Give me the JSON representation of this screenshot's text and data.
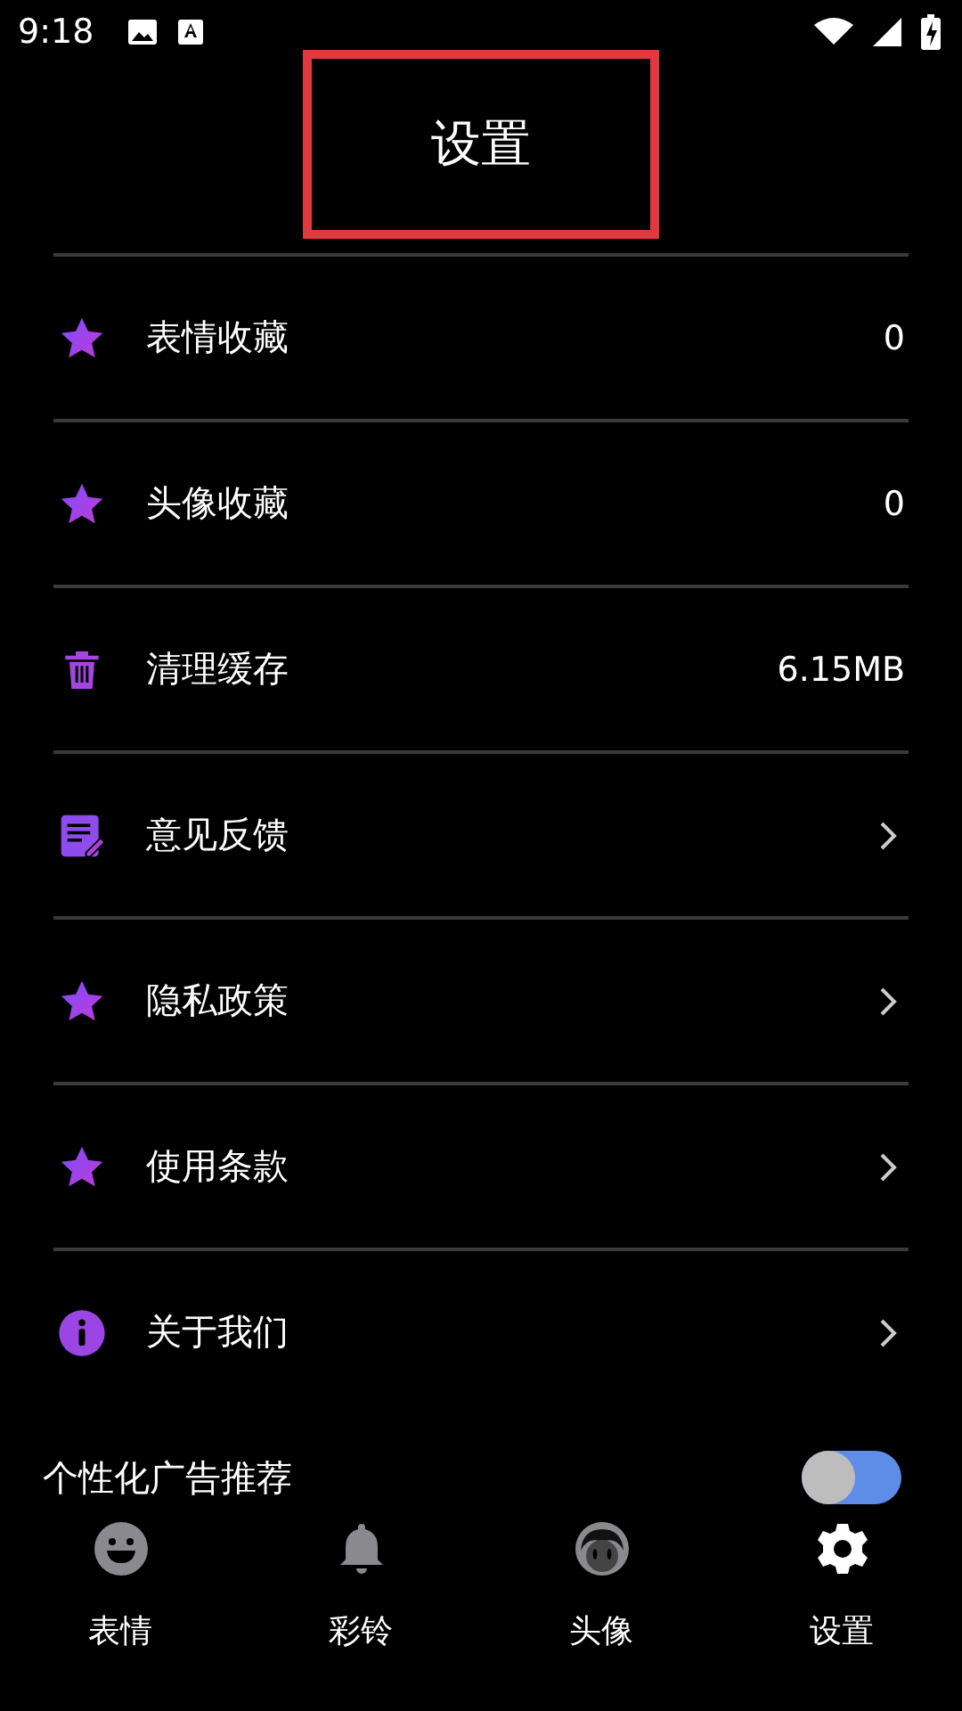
{
  "status_bar": {
    "time": "9:18"
  },
  "title": "设置",
  "settings": [
    {
      "label": "表情收藏",
      "kind": "value",
      "value": "0"
    },
    {
      "label": "头像收藏",
      "kind": "value",
      "value": "0"
    },
    {
      "label": "清理缓存",
      "kind": "value",
      "value": "6.15MB"
    },
    {
      "label": "意见反馈",
      "kind": "link"
    },
    {
      "label": "隐私政策",
      "kind": "link"
    },
    {
      "label": "使用条款",
      "kind": "link"
    },
    {
      "label": "关于我们",
      "kind": "link"
    }
  ],
  "ad_toggle": {
    "label": "个性化广告推荐",
    "on": false
  },
  "bottom_nav": [
    {
      "label": "表情",
      "selected": false
    },
    {
      "label": "彩铃",
      "selected": false
    },
    {
      "label": "头像",
      "selected": false
    },
    {
      "label": "设置",
      "selected": true
    }
  ]
}
